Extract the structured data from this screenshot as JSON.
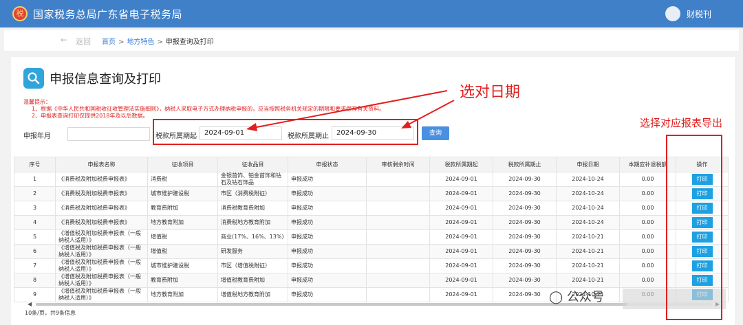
{
  "header": {
    "logo_text": "税",
    "app_title": "国家税务总局广东省电子税务局",
    "user_name": "财税刊"
  },
  "nav": {
    "back_label": "返回",
    "breadcrumb": [
      "首页",
      "地方特色",
      "申报查询及打印"
    ]
  },
  "page": {
    "title": "申报信息查询及打印"
  },
  "notice": {
    "title": "温馨提示：",
    "items": [
      "1、根据《中华人民共和国税收征收管理法实施细则》，纳税人采取电子方式办理纳税申报的，应当按照税务机关规定的期限和要求保存有关资料。",
      "2、申报表查询打印仅提供2018年及以后数据。"
    ]
  },
  "filters": {
    "year_label": "申报年月",
    "year_value": "",
    "period_start_label": "税款所属期起",
    "period_start_value": "2024-09-01",
    "period_end_label": "税款所属期止",
    "period_end_value": "2024-09-30",
    "query_button": "查询"
  },
  "annotations": {
    "date_tip": "选对日期",
    "export_tip": "选择对应报表导出",
    "color": "#e02020"
  },
  "table": {
    "columns": [
      "序号",
      "申报表名称",
      "征收项目",
      "征收品目",
      "申报状态",
      "审核剩余时间",
      "税款所属期起",
      "税款所属期止",
      "申报日期",
      "本期应补退税额",
      "操作"
    ],
    "rows": [
      [
        "1",
        "《消费税及附加税费申报表》",
        "消费税",
        "金银首饰、铂金首饰和钻石及钻石饰品",
        "申报成功",
        "",
        "2024-09-01",
        "2024-09-30",
        "2024-10-24",
        "0.00",
        "打印"
      ],
      [
        "2",
        "《消费税及附加税费申报表》",
        "城市维护建设税",
        "市区（消费税附征）",
        "申报成功",
        "",
        "2024-09-01",
        "2024-09-30",
        "2024-10-24",
        "0.00",
        "打印"
      ],
      [
        "3",
        "《消费税及附加税费申报表》",
        "教育费附加",
        "消费税教育费附加",
        "申报成功",
        "",
        "2024-09-01",
        "2024-09-30",
        "2024-10-24",
        "0.00",
        "打印"
      ],
      [
        "4",
        "《消费税及附加税费申报表》",
        "地方教育附加",
        "消费税地方教育附加",
        "申报成功",
        "",
        "2024-09-01",
        "2024-09-30",
        "2024-10-24",
        "0.00",
        "打印"
      ],
      [
        "5",
        "《增值税及附加税费申报表（一般纳税人适用）》",
        "增值税",
        "商业(17%、16%、13%)",
        "申报成功",
        "",
        "2024-09-01",
        "2024-09-30",
        "2024-10-21",
        "0.00",
        "打印"
      ],
      [
        "6",
        "《增值税及附加税费申报表（一般纳税人适用）》",
        "增值税",
        "研发服务",
        "申报成功",
        "",
        "2024-09-01",
        "2024-09-30",
        "2024-10-21",
        "0.00",
        "打印"
      ],
      [
        "7",
        "《增值税及附加税费申报表（一般纳税人适用）》",
        "城市维护建设税",
        "市区（增值税附征）",
        "申报成功",
        "",
        "2024-09-01",
        "2024-09-30",
        "2024-10-21",
        "0.00",
        "打印"
      ],
      [
        "8",
        "《增值税及附加税费申报表（一般纳税人适用）》",
        "教育费附加",
        "增值税教育费附加",
        "申报成功",
        "",
        "2024-09-01",
        "2024-09-30",
        "2024-10-21",
        "0.00",
        "打印"
      ],
      [
        "9",
        "《增值税及附加税费申报表（一般纳税人适用）》",
        "地方教育附加",
        "增值税地方教育附加",
        "申报成功",
        "",
        "2024-09-01",
        "2024-09-30",
        "2024-10-21",
        "0.00",
        "打印"
      ]
    ]
  },
  "pagination": {
    "summary": "10条/页，共9条信息"
  },
  "scroll": {
    "left_icon": "scroll-left-icon",
    "right_icon": "scroll-right-icon"
  },
  "watermark": {
    "text": "公众号"
  }
}
